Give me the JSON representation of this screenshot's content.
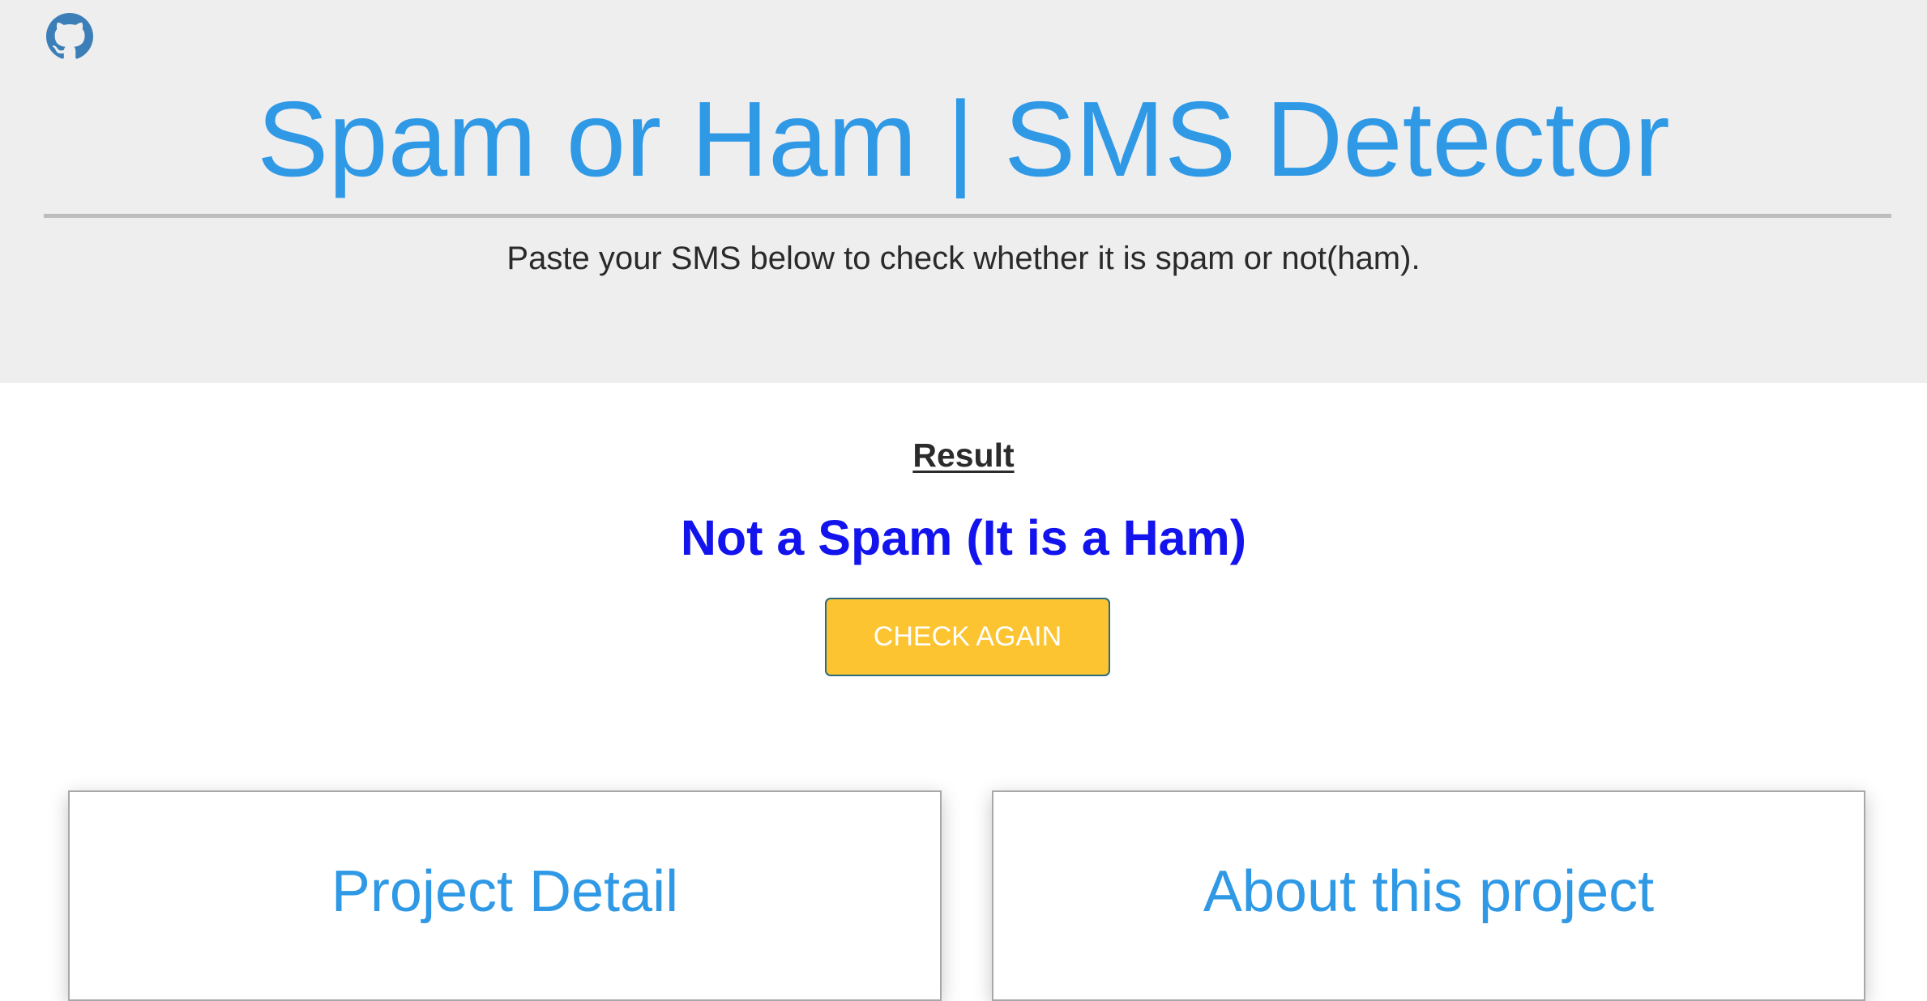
{
  "header": {
    "title": "Spam or Ham | SMS Detector",
    "subtitle": "Paste your SMS below to check whether it is spam or not(ham).",
    "github_icon": "github-icon"
  },
  "result": {
    "heading": "Result",
    "text": "Not a Spam (It is a Ham)",
    "check_again_label": "CHECK AGAIN"
  },
  "cards": {
    "project_detail_title": "Project Detail",
    "about_title": "About this project"
  },
  "colors": {
    "header_bg": "#eeeeef",
    "title_blue": "#2f99e6",
    "result_blue": "#1313ee",
    "button_yellow": "#fcc431",
    "github_blue": "#3c7fb8"
  }
}
